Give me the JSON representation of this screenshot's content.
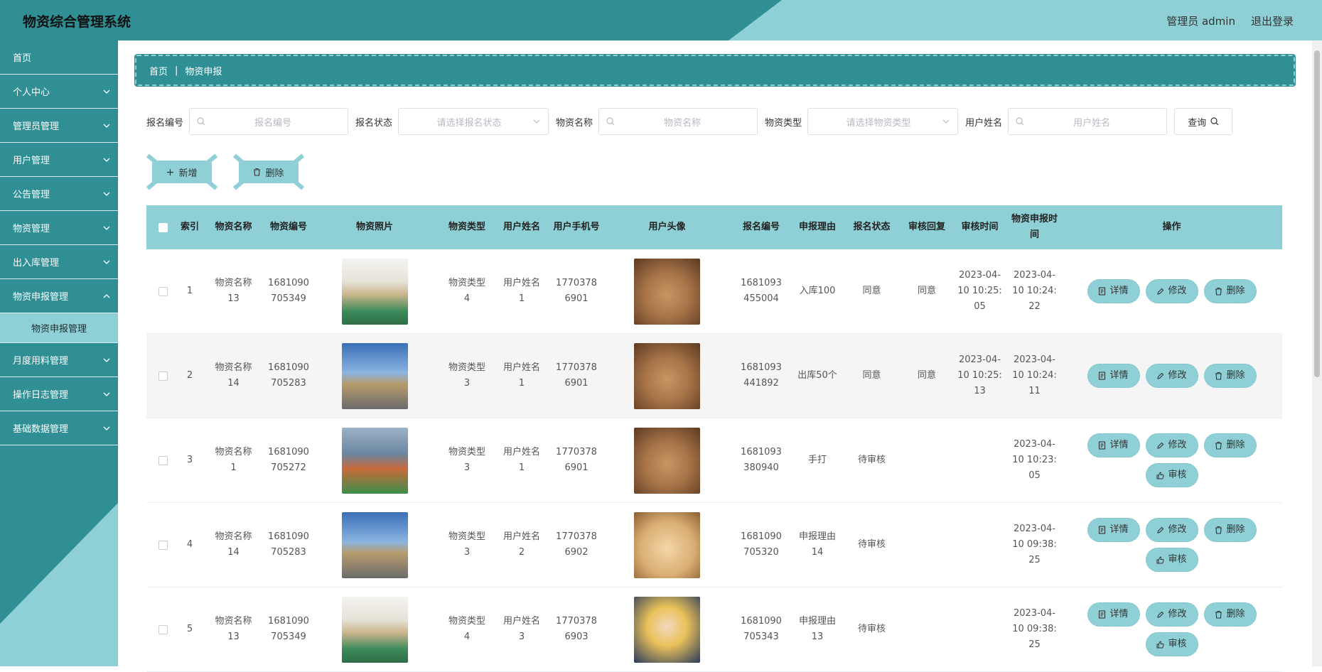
{
  "header": {
    "title": "物资综合管理系统",
    "user": "管理员 admin",
    "logout": "退出登录"
  },
  "sidebar": {
    "items": [
      {
        "label": "首页"
      },
      {
        "label": "个人中心"
      },
      {
        "label": "管理员管理"
      },
      {
        "label": "用户管理"
      },
      {
        "label": "公告管理"
      },
      {
        "label": "物资管理"
      },
      {
        "label": "出入库管理"
      },
      {
        "label": "物资申报管理"
      },
      {
        "label": "物资申报管理"
      },
      {
        "label": "月度用料管理"
      },
      {
        "label": "操作日志管理"
      },
      {
        "label": "基础数据管理"
      }
    ]
  },
  "breadcrumb": {
    "home": "首页",
    "sep": "|",
    "current": "物资申报"
  },
  "search": {
    "f1_label": "报名编号",
    "f1_placeholder": "报名编号",
    "f2_label": "报名状态",
    "f2_placeholder": "请选择报名状态",
    "f3_label": "物资名称",
    "f3_placeholder": "物资名称",
    "f4_label": "物资类型",
    "f4_placeholder": "请选择物资类型",
    "f5_label": "用户姓名",
    "f5_placeholder": "用户姓名",
    "query": "查询"
  },
  "actions": {
    "add": "新增",
    "delete": "删除"
  },
  "table": {
    "headers": {
      "index": "索引",
      "name": "物资名称",
      "code": "物资编号",
      "photo": "物资照片",
      "type": "物资类型",
      "user": "用户姓名",
      "phone": "用户手机号",
      "avatar": "用户头像",
      "no": "报名编号",
      "reason": "申报理由",
      "status": "报名状态",
      "reply": "审核回复",
      "audit_time": "审核时间",
      "create_time": "物资申报时间",
      "ops": "操作"
    },
    "op_labels": {
      "detail": "详情",
      "edit": "修改",
      "delete": "删除",
      "audit": "审核"
    },
    "rows": [
      {
        "index": "1",
        "name": "物资名称13",
        "code": "1681090705349",
        "type": "物资类型4",
        "user": "用户姓名1",
        "phone": "17703786901",
        "no": "1681093455004",
        "reason": "入库100",
        "status": "同意",
        "reply": "同意",
        "audit_time": "2023-04-10 10:25:05",
        "create_time": "2023-04-10 10:24:22"
      },
      {
        "index": "2",
        "name": "物资名称14",
        "code": "1681090705283",
        "type": "物资类型3",
        "user": "用户姓名1",
        "phone": "17703786901",
        "no": "1681093441892",
        "reason": "出库50个",
        "status": "同意",
        "reply": "同意",
        "audit_time": "2023-04-10 10:25:13",
        "create_time": "2023-04-10 10:24:11"
      },
      {
        "index": "3",
        "name": "物资名称1",
        "code": "1681090705272",
        "type": "物资类型3",
        "user": "用户姓名1",
        "phone": "17703786901",
        "no": "1681093380940",
        "reason": "手打",
        "status": "待审核",
        "reply": "",
        "audit_time": "",
        "create_time": "2023-04-10 10:23:05"
      },
      {
        "index": "4",
        "name": "物资名称14",
        "code": "1681090705283",
        "type": "物资类型3",
        "user": "用户姓名2",
        "phone": "17703786902",
        "no": "1681090705320",
        "reason": "申报理由14",
        "status": "待审核",
        "reply": "",
        "audit_time": "",
        "create_time": "2023-04-10 09:38:25"
      },
      {
        "index": "5",
        "name": "物资名称13",
        "code": "1681090705349",
        "type": "物资类型4",
        "user": "用户姓名3",
        "phone": "17703786903",
        "no": "1681090705343",
        "reason": "申报理由13",
        "status": "待审核",
        "reply": "",
        "audit_time": "",
        "create_time": "2023-04-10 09:38:25"
      }
    ]
  }
}
